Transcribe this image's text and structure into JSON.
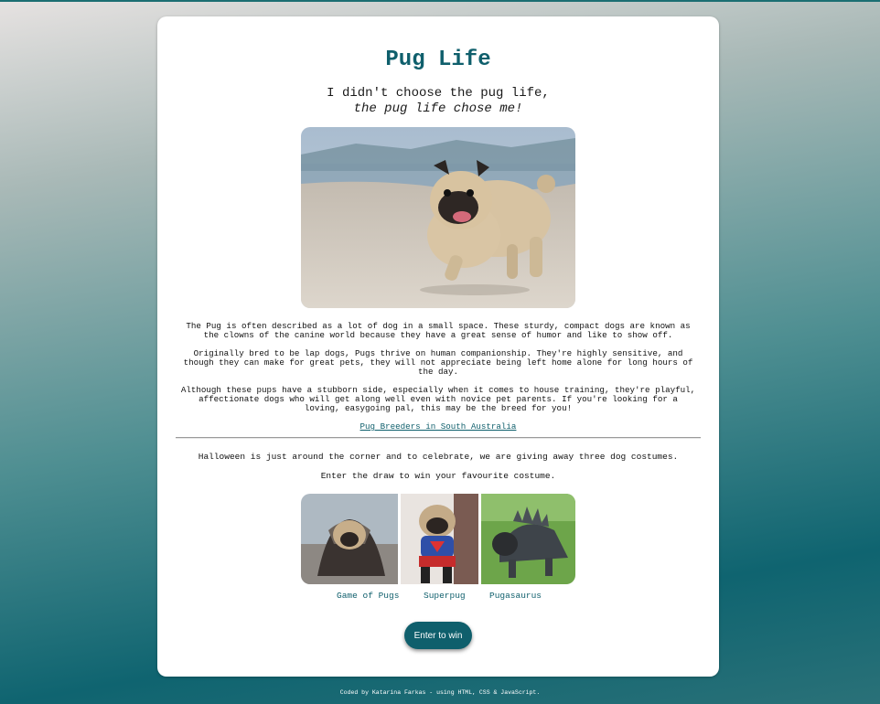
{
  "page": {
    "title": "Pug Life",
    "quote_line1": "I didn't choose the pug life,",
    "quote_line2": "the pug life chose me!",
    "paragraphs": [
      "The Pug is often described as a lot of dog in a small space. These sturdy, compact dogs are known as the clowns of the canine world because they have a great sense of humor and like to show off.",
      "Originally bred to be lap dogs, Pugs thrive on human companionship. They're highly sensitive, and though they can make for great pets, they will not appreciate being left home alone for long hours of the day.",
      "Although these pups have a stubborn side, especially when it comes to house training, they're playful, affectionate dogs who will get along well even with novice pet parents. If you're looking for a loving, easygoing pal, this may be the breed for you!"
    ],
    "breeders_link": "Pug Breeders in South Australia"
  },
  "promo": {
    "line1": "Halloween is just around the corner and to celebrate, we are giving away three dog costumes.",
    "line2": "Enter the draw to win your favourite costume.",
    "costumes": [
      "Game of Pugs",
      "Superpug",
      "Pugasaurus"
    ],
    "button": "Enter to win"
  },
  "footer": "Coded by Katarina Farkas - using HTML, CSS & JavaScript.",
  "colors": {
    "accent": "#0f5f6c",
    "card": "#ffffff"
  }
}
